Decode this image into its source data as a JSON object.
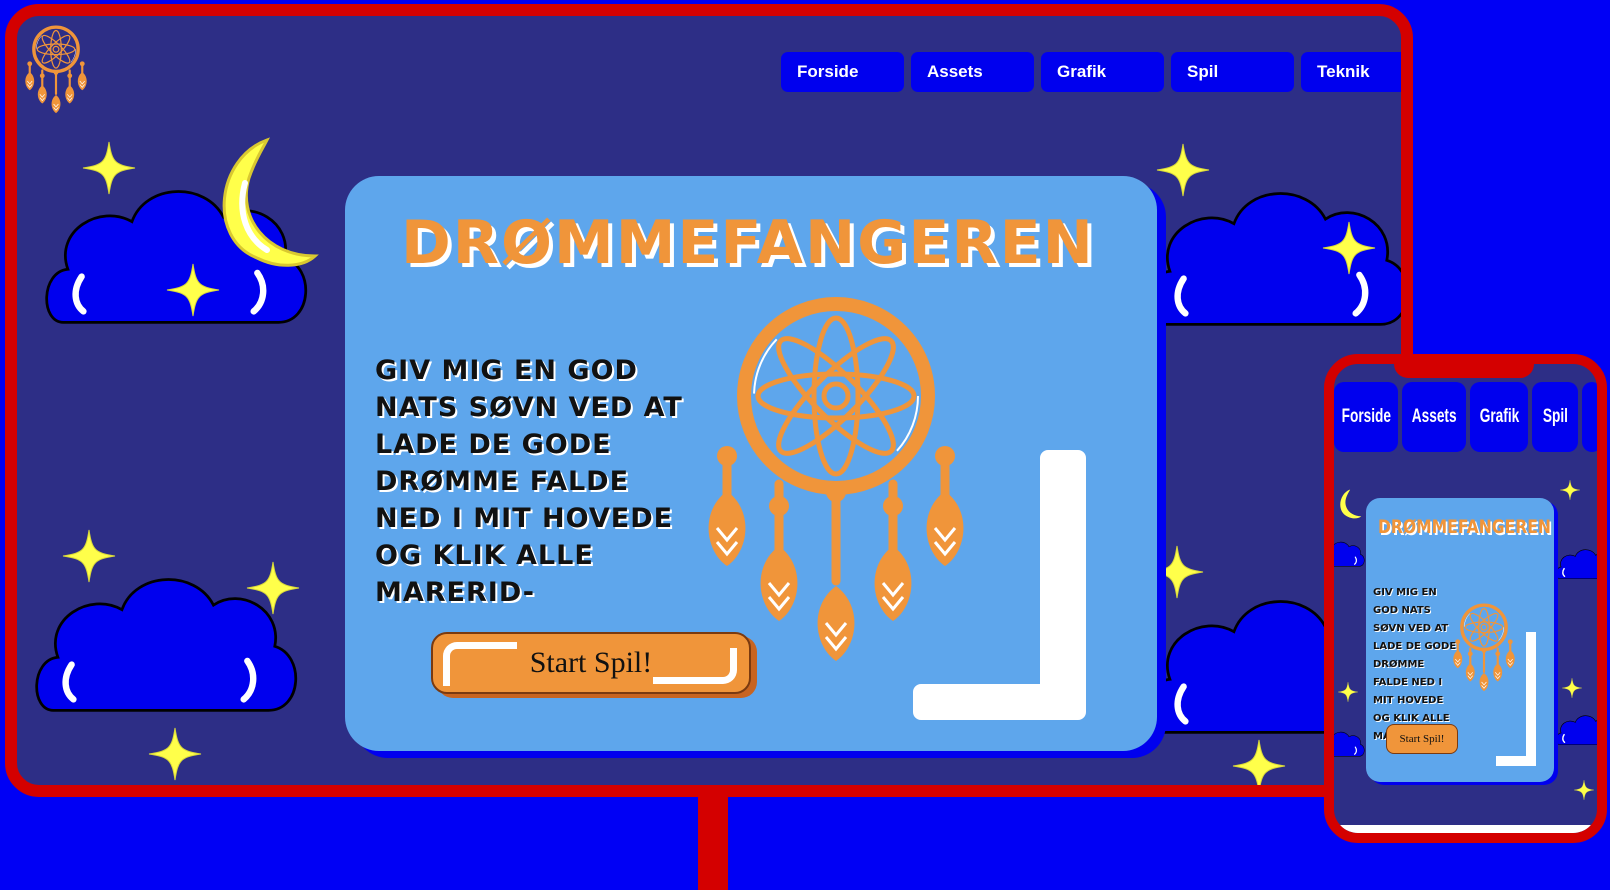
{
  "nav": {
    "items": [
      "Forside",
      "Assets",
      "Grafik",
      "Spil",
      "Teknik"
    ]
  },
  "hero": {
    "title": "DRØMMEFANGEREN",
    "text": "Giv mig en god nats søvn ved at lade de gode drømme falde ned i mit hovede og klik alle marerid-",
    "button_label": "Start Spil!"
  },
  "phone": {
    "nav_items": [
      "Forside",
      "Assets",
      "Grafik",
      "Spil",
      ""
    ],
    "title": "DRØMMEFANGEREN",
    "text": "Giv mig en god nats søvn ved at lade de gode drømme falde ned i mit hovede og klik alle marerid-",
    "button_label": "Start Spil!"
  },
  "icons": [
    "dreamcatcher-logo-icon",
    "moon-icon",
    "star-icon",
    "cloud-icon",
    "dreamcatcher-icon"
  ],
  "colors": {
    "background": "#0000f5",
    "frame": "#d40000",
    "screen": "#2d2e86",
    "card": "#5ea6ec",
    "accent_orange": "#f0953a",
    "nav_blue": "#0000ee",
    "star_yellow": "#ffff4a"
  }
}
